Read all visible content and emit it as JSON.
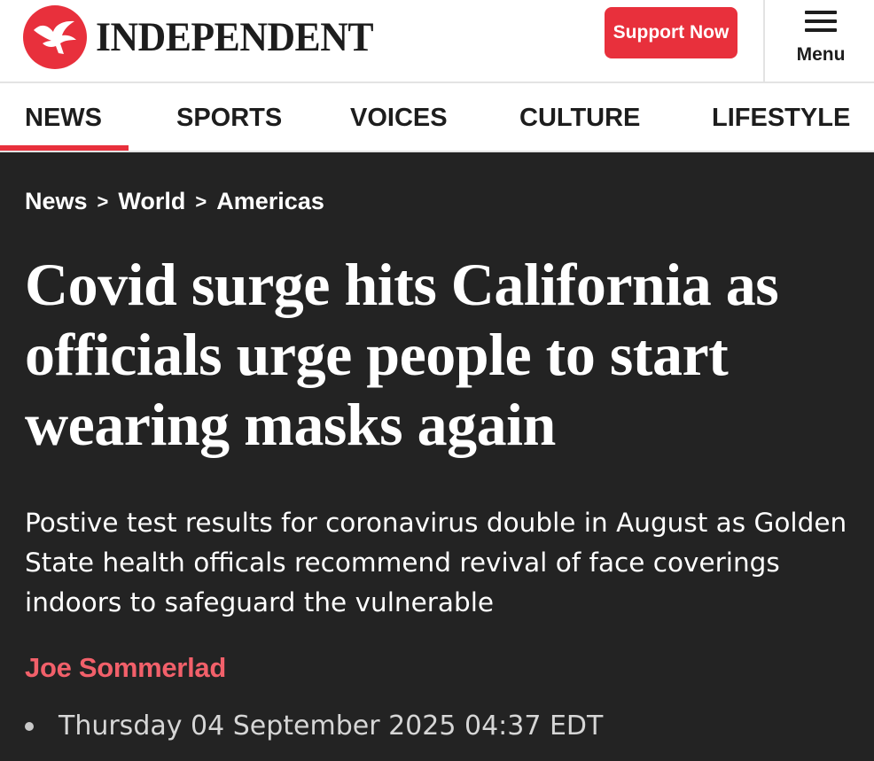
{
  "brand": {
    "name": "INDEPENDENT",
    "logo_icon": "eagle-logo-icon",
    "accent_color": "#e8303c"
  },
  "header": {
    "support_label": "Support Now",
    "menu_label": "Menu",
    "menu_icon": "hamburger-menu-icon"
  },
  "nav": {
    "items": [
      {
        "label": "NEWS",
        "active": true
      },
      {
        "label": "SPORTS",
        "active": false
      },
      {
        "label": "VOICES",
        "active": false
      },
      {
        "label": "CULTURE",
        "active": false
      },
      {
        "label": "LIFESTYLE",
        "active": false
      }
    ]
  },
  "breadcrumb": {
    "items": [
      "News",
      "World",
      "Americas"
    ],
    "separator": ">"
  },
  "article": {
    "headline": "Covid surge hits California as officials urge people to start wearing masks again",
    "standfirst": "Postive test results for coronavirus double in August as Golden State health officals recommend revival of face coverings indoors to safeguard the vulnerable",
    "author": "Joe Sommerlad",
    "date": "Thursday 04 September 2025 04:37 EDT",
    "background_color": "#232323",
    "author_color": "#f2606a"
  }
}
